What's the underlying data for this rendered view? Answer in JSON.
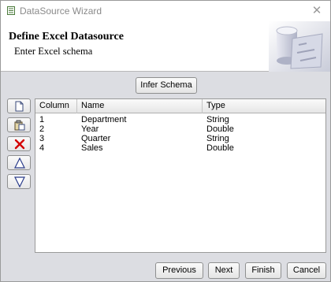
{
  "window": {
    "title": "DataSource Wizard",
    "close_glyph": "✕"
  },
  "banner": {
    "title": "Define Excel Datasource",
    "subtitle": "Enter Excel schema"
  },
  "infer_label": "Infer Schema",
  "toolbar": {
    "icons": [
      "new-row-icon",
      "paste-row-icon",
      "delete-icon",
      "move-up-icon",
      "move-down-icon"
    ],
    "delete_color": "#d40000",
    "arrow_color": "#2a3c8a"
  },
  "table": {
    "columns": [
      "Column",
      "Name",
      "Type"
    ],
    "rows": [
      {
        "column": "1",
        "name": "Department",
        "type": "String"
      },
      {
        "column": "2",
        "name": "Year",
        "type": "Double"
      },
      {
        "column": "3",
        "name": "Quarter",
        "type": "String"
      },
      {
        "column": "4",
        "name": "Sales",
        "type": "Double"
      }
    ]
  },
  "buttons": {
    "previous": "Previous",
    "next": "Next",
    "finish": "Finish",
    "cancel": "Cancel"
  }
}
